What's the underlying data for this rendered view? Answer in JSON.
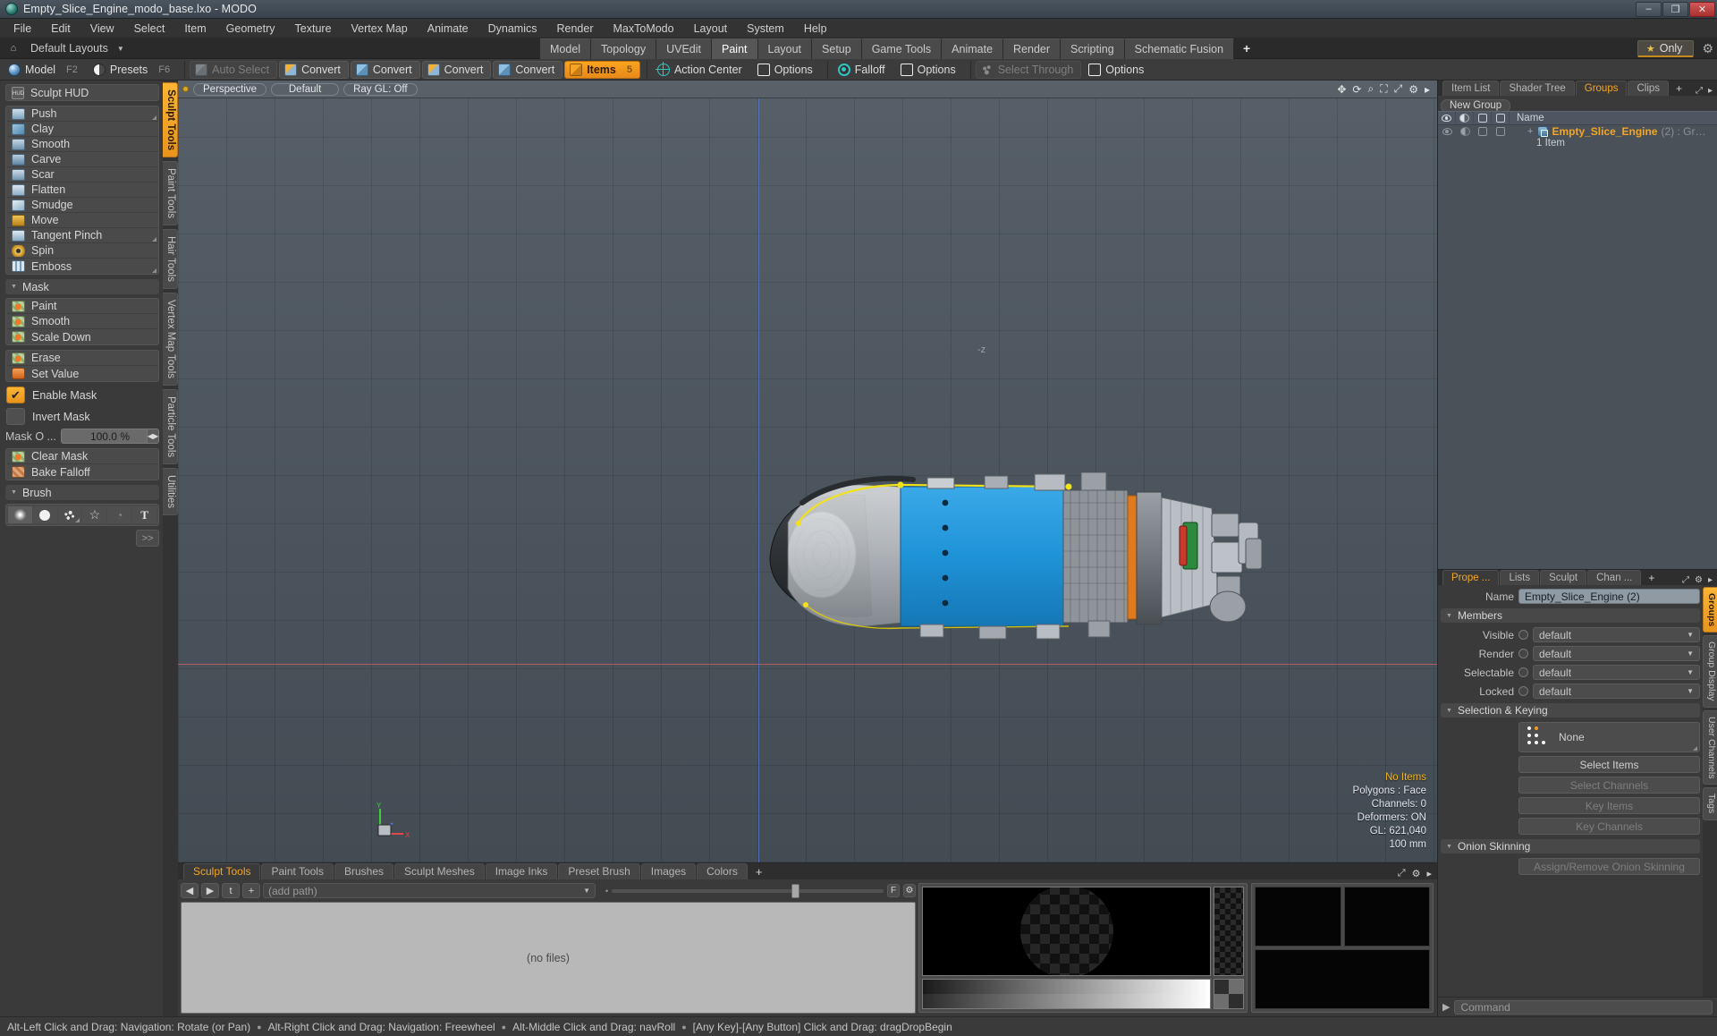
{
  "window": {
    "title": "Empty_Slice_Engine_modo_base.lxo - MODO",
    "app_icon": "modo-logo-icon",
    "minimize": "–",
    "maximize": "❐",
    "close": "✕"
  },
  "menubar": {
    "items": [
      "File",
      "Edit",
      "View",
      "Select",
      "Item",
      "Geometry",
      "Texture",
      "Vertex Map",
      "Animate",
      "Dynamics",
      "Render",
      "MaxToModo",
      "Layout",
      "System",
      "Help"
    ]
  },
  "layoutbar": {
    "home_icon": "home-icon",
    "default_layouts": "Default Layouts",
    "caret": "▼",
    "tabs": [
      {
        "label": "Model",
        "active": false
      },
      {
        "label": "Topology",
        "active": false
      },
      {
        "label": "UVEdit",
        "active": false
      },
      {
        "label": "Paint",
        "active": true
      },
      {
        "label": "Layout",
        "active": false
      },
      {
        "label": "Setup",
        "active": false
      },
      {
        "label": "Game Tools",
        "active": false
      },
      {
        "label": "Animate",
        "active": false
      },
      {
        "label": "Render",
        "active": false
      },
      {
        "label": "Scripting",
        "active": false
      },
      {
        "label": "Schematic Fusion",
        "active": false
      }
    ],
    "add_tab": "+",
    "only_label": "Only",
    "only_star": "★",
    "gear": "⚙"
  },
  "toolbar": {
    "mode_buttons": [
      {
        "label": "Model",
        "hotkey": "F2",
        "icon": "sphere-icon"
      },
      {
        "label": "Presets",
        "hotkey": "F6",
        "icon": "half-sphere-icon"
      }
    ],
    "select_buttons": [
      {
        "label": "Auto Select",
        "icon": "cube-grey-icon",
        "dim": true
      },
      {
        "label": "Convert",
        "icon": "cube-vertex-icon",
        "dim": false
      },
      {
        "label": "Convert",
        "icon": "cube-edge-icon",
        "dim": false
      },
      {
        "label": "Convert",
        "icon": "cube-poly-icon",
        "dim": false
      },
      {
        "label": "Convert",
        "icon": "cube-item-icon",
        "dim": false
      }
    ],
    "items_button": {
      "label": "Items",
      "count": "5",
      "icon": "cube-orange-icon"
    },
    "action_center": {
      "label": "Action Center",
      "icon": "crosshair-icon"
    },
    "options_1": {
      "label": "Options",
      "icon": "square-icon"
    },
    "falloff": {
      "label": "Falloff",
      "icon": "target-icon"
    },
    "options_2": {
      "label": "Options",
      "icon": "square-icon"
    },
    "select_through": {
      "label": "Select Through",
      "icon": "through-icon"
    },
    "options_3": {
      "label": "Options",
      "icon": "square-icon"
    }
  },
  "sculpt_panel": {
    "hud_button": {
      "label": "Sculpt HUD",
      "icon": "hud-icon"
    },
    "tools": [
      {
        "label": "Push",
        "icon": "push-icon",
        "corner": true
      },
      {
        "label": "Clay",
        "icon": "clay-icon",
        "corner": false
      },
      {
        "label": "Smooth",
        "icon": "smooth-icon",
        "corner": false
      },
      {
        "label": "Carve",
        "icon": "carve-icon",
        "corner": false
      },
      {
        "label": "Scar",
        "icon": "scar-icon",
        "corner": false
      },
      {
        "label": "Flatten",
        "icon": "flatten-icon",
        "corner": false
      },
      {
        "label": "Smudge",
        "icon": "smudge-icon",
        "corner": false
      },
      {
        "label": "Move",
        "icon": "move-icon",
        "corner": false
      },
      {
        "label": "Tangent Pinch",
        "icon": "pinch-icon",
        "corner": true
      },
      {
        "label": "Spin",
        "icon": "spin-icon",
        "corner": false
      },
      {
        "label": "Emboss",
        "icon": "emboss-icon",
        "corner": true
      }
    ],
    "mask_section": "Mask",
    "mask_tools": [
      {
        "label": "Paint",
        "icon": "mask-paint-icon"
      },
      {
        "label": "Smooth",
        "icon": "mask-smooth-icon"
      },
      {
        "label": "Scale Down",
        "icon": "mask-scale-icon"
      }
    ],
    "mask_tools2": [
      {
        "label": "Erase",
        "icon": "mask-erase-icon"
      },
      {
        "label": "Set Value",
        "icon": "mask-setvalue-icon"
      }
    ],
    "enable_mask": {
      "label": "Enable Mask",
      "checked": true,
      "check": "✔"
    },
    "invert_mask": {
      "label": "Invert Mask",
      "checked": false
    },
    "mask_opacity": {
      "label": "Mask O ...",
      "value": "100.0 %",
      "spin": "◀▶"
    },
    "clear_mask": {
      "label": "Clear Mask",
      "icon": "clear-mask-icon"
    },
    "bake_falloff": {
      "label": "Bake Falloff",
      "icon": "bake-falloff-icon"
    },
    "brush_section": "Brush",
    "brush_icons": [
      "soft-dot-icon",
      "hard-dot-icon",
      "spatter-icon",
      "star-icon",
      "image-ink-icon",
      "text-icon"
    ],
    "brush_more": ">>"
  },
  "left_vtabs": [
    {
      "label": "Sculpt Tools",
      "active": true
    },
    {
      "label": "Paint Tools",
      "active": false
    },
    {
      "label": "Hair Tools",
      "active": false
    },
    {
      "label": "Vertex Map Tools",
      "active": false
    },
    {
      "label": "Particle Tools",
      "active": false
    },
    {
      "label": "Utilities",
      "active": false
    }
  ],
  "viewport": {
    "dot_icon": "view-indicator-icon",
    "pills": [
      "Perspective",
      "Default",
      "Ray GL: Off"
    ],
    "tool_icons": [
      "move-view-icon",
      "rotate-view-icon",
      "zoom-view-icon",
      "fit-view-icon",
      "maximize-icon",
      "gear-icon",
      "collapse-icon"
    ],
    "axis_label_z": "-z",
    "gizmo_axes": [
      "Y",
      "X",
      "Z"
    ],
    "stats": {
      "selection": "No Items",
      "polygons": "Polygons : Face",
      "channels": "Channels: 0",
      "deformers": "Deformers: ON",
      "gl": "GL: 621,040",
      "scale": "100 mm"
    }
  },
  "bottom_panel": {
    "tabs": [
      {
        "label": "Sculpt Tools",
        "active": true
      },
      {
        "label": "Paint Tools",
        "active": false
      },
      {
        "label": "Brushes",
        "active": false
      },
      {
        "label": "Sculpt Meshes",
        "active": false
      },
      {
        "label": "Image Inks",
        "active": false
      },
      {
        "label": "Preset Brush",
        "active": false
      },
      {
        "label": "Images",
        "active": false
      },
      {
        "label": "Colors",
        "active": false
      }
    ],
    "add_tab": "+",
    "panel_icons": [
      "expand-icon",
      "gear-icon",
      "collapse-icon"
    ],
    "nav": {
      "back": "◀",
      "forward": "▶",
      "up": "t",
      "add": "+"
    },
    "path_placeholder": "(add path)",
    "path_caret": "▼",
    "files_empty": "(no files)",
    "thumb_label": "F",
    "thumb_gear": "⚙"
  },
  "right_panel": {
    "tabs": [
      {
        "label": "Item List",
        "active": false
      },
      {
        "label": "Shader Tree",
        "active": false
      },
      {
        "label": "Groups",
        "active": true
      },
      {
        "label": "Clips",
        "active": false
      }
    ],
    "add_tab": "+",
    "ctl_icons": [
      "expand-icon",
      "more-icon"
    ],
    "new_group": "New Group",
    "columns": [
      "eye-icon",
      "shading-icon",
      "render-icon",
      "selectable-icon"
    ],
    "name_column": "Name",
    "rows": [
      {
        "expand": "+",
        "icon": "group-icon",
        "name": "Empty_Slice_Engine",
        "meta": "(2) : Gr…",
        "sub": "1 Item"
      }
    ]
  },
  "properties": {
    "tabs": [
      {
        "label": "Prope ...",
        "active": true
      },
      {
        "label": "Lists",
        "active": false
      },
      {
        "label": "Sculpt",
        "active": false
      },
      {
        "label": "Chan ...",
        "active": false
      }
    ],
    "add_tab": "+",
    "ctl_icons": [
      "expand-icon",
      "gear-icon",
      "more-icon"
    ],
    "name_label": "Name",
    "name_value": "Empty_Slice_Engine (2)",
    "members_section": "Members",
    "members": [
      {
        "label": "Visible",
        "value": "default"
      },
      {
        "label": "Render",
        "value": "default"
      },
      {
        "label": "Selectable",
        "value": "default"
      },
      {
        "label": "Locked",
        "value": "default"
      }
    ],
    "selection_section": "Selection & Keying",
    "selection_mode": {
      "label": "None",
      "icon": "selection-dots-icon"
    },
    "buttons": [
      {
        "label": "Select Items",
        "enabled": true
      },
      {
        "label": "Select Channels",
        "enabled": false
      },
      {
        "label": "Key Items",
        "enabled": false
      },
      {
        "label": "Key Channels",
        "enabled": false
      }
    ],
    "onion_section": "Onion Skinning",
    "onion_button": {
      "label": "Assign/Remove Onion Skinning",
      "enabled": false
    },
    "vtabs": [
      {
        "label": "Groups",
        "active": true
      },
      {
        "label": "Group Display",
        "active": false
      },
      {
        "label": "User Channels",
        "active": false
      },
      {
        "label": "Tags",
        "active": false
      }
    ]
  },
  "command": {
    "arrow": "▶",
    "placeholder": "Command"
  },
  "statusbar": {
    "hints": [
      "Alt-Left Click and Drag: Navigation: Rotate (or Pan)",
      "Alt-Right Click and Drag: Navigation: Freewheel",
      "Alt-Middle Click and Drag: navRoll",
      "[Any Key]-[Any Button] Click and Drag: dragDropBegin"
    ],
    "separator": "●"
  },
  "colors": {
    "accent": "#f5a623",
    "selection_blue": "#2196d9",
    "highlight_yellow": "#e8d000",
    "panel_bg": "#3a3a3a",
    "viewport_bg": "#4d565f"
  }
}
